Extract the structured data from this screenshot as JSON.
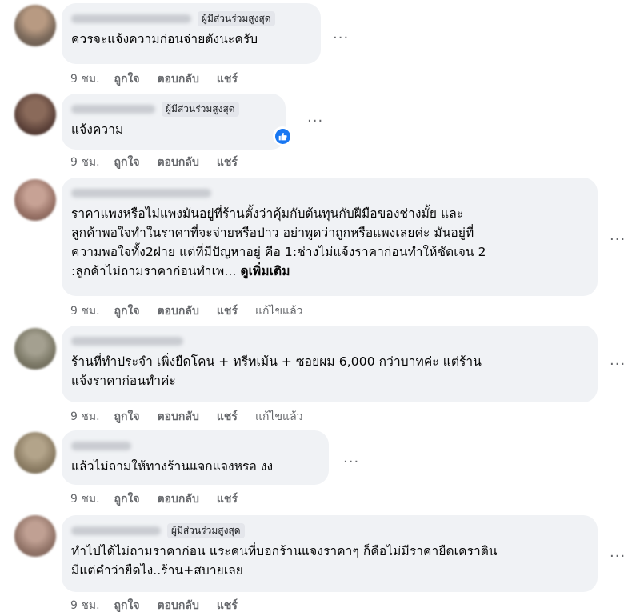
{
  "colors": {
    "bubble_bg": "#f0f2f5",
    "meta_text": "#65676b",
    "like_blue": "#1877f2"
  },
  "icons": {
    "more": "more-options-icon",
    "like": "thumbs-up-icon"
  },
  "comments": [
    {
      "badge": "ผู้มีส่วนร่วมสูงสุด",
      "text": "ควรจะแจ้งความก่อนจ่ายตังนะครับ",
      "time": "9 ชม.",
      "like": "ถูกใจ",
      "reply": "ตอบกลับ",
      "share": "แชร์"
    },
    {
      "badge": "ผู้มีส่วนร่วมสูงสุด",
      "text": "แจ้งความ",
      "time": "9 ชม.",
      "like": "ถูกใจ",
      "reply": "ตอบกลับ",
      "share": "แชร์"
    },
    {
      "text": "ราคาแพงหรือไม่แพงมันอยู่ที่ร้านตั้งว่าคุ้มกับต้นทุนกับฝีมือของช่างมั้ย และ\nลูกค้าพอใจทำในราคาที่จะจ่ายหรือป่าว อย่าพูดว่าถูกหรือแพงเลยค่ะ มันอยู่ที่\nความพอใจทั้ง2ฝ่าย แต่ที่มีปัญหาอยู่ คือ 1:ช่างไม่แจ้งราคาก่อนทำให้ชัดเจน 2\n:ลูกค้าไม่ถามราคาก่อนทำเพ... ",
      "see_more": "ดูเพิ่มเติม",
      "time": "9 ชม.",
      "like": "ถูกใจ",
      "reply": "ตอบกลับ",
      "share": "แชร์",
      "edited": "แก้ไขแล้ว"
    },
    {
      "text": "ร้านที่ทำประจำ เพิ่งยืดโคน + ทรีทเม้น + ซอยผม 6,000 กว่าบาทค่ะ แต่ร้าน\nแจ้งราคาก่อนทำค่ะ",
      "time": "9 ชม.",
      "like": "ถูกใจ",
      "reply": "ตอบกลับ",
      "share": "แชร์",
      "edited": "แก้ไขแล้ว"
    },
    {
      "text": "แล้วไม่ถามให้ทางร้านแจกแจงหรอ งง",
      "time": "9 ชม.",
      "like": "ถูกใจ",
      "reply": "ตอบกลับ",
      "share": "แชร์"
    },
    {
      "badge": "ผู้มีส่วนร่วมสูงสุด",
      "text": "ทำไปได้ไม่ถามราคาก่อน แระคนที่บอกร้านแจงราคาๆ ก็คือไม่มีราคายืดเคราติน\nมีแต่คำว่ายืดไง..ร้าน+สบายเลย",
      "time": "9 ชม.",
      "like": "ถูกใจ",
      "reply": "ตอบกลับ",
      "share": "แชร์"
    }
  ]
}
